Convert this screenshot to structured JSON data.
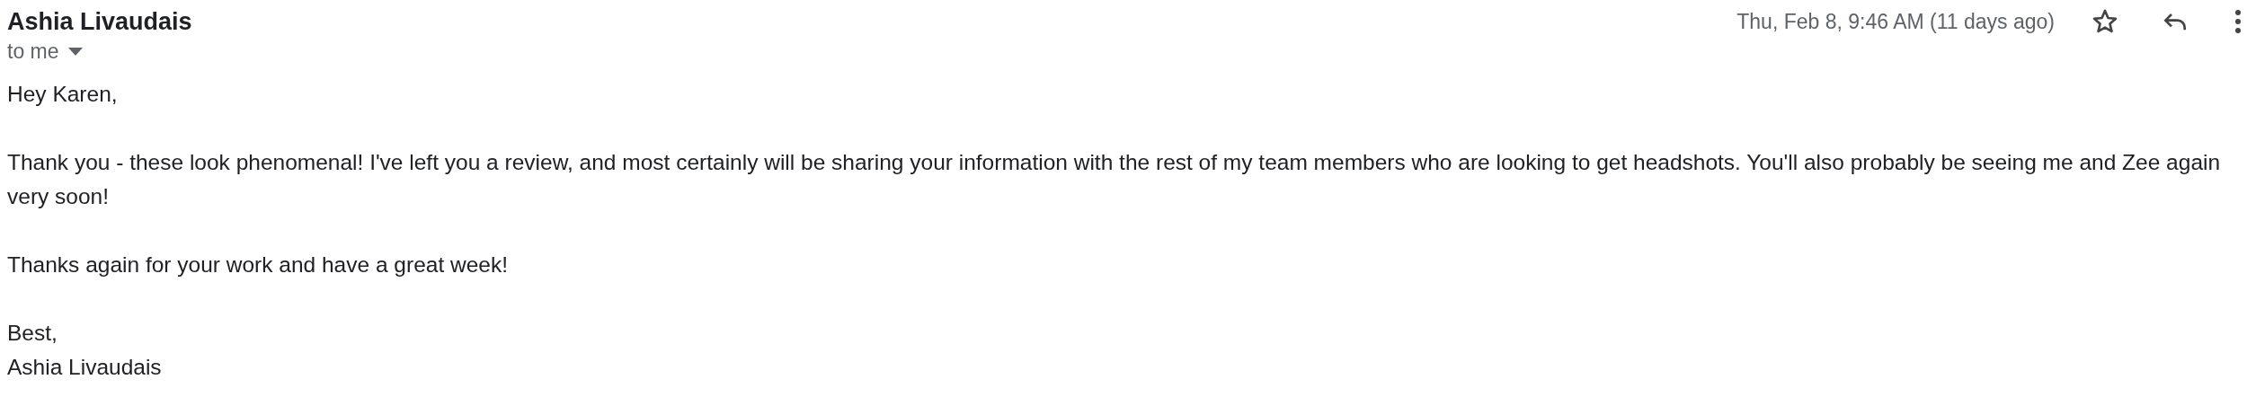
{
  "sender": {
    "name": "Ashia Livaudais",
    "recipient": "to me"
  },
  "date": "Thu, Feb 8, 9:46 AM (11 days ago)",
  "body": {
    "greeting": "Hey Karen,",
    "paragraphs": [
      "Thank you - these look phenomenal! I've left you a review, and most certainly will be sharing your information with the rest of my team members who are looking to get headshots. You'll also probably be seeing me and Zee again very soon!",
      "Thanks again for your work and have a great week!"
    ],
    "signature": [
      "Best,",
      "Ashia Livaudais"
    ]
  }
}
